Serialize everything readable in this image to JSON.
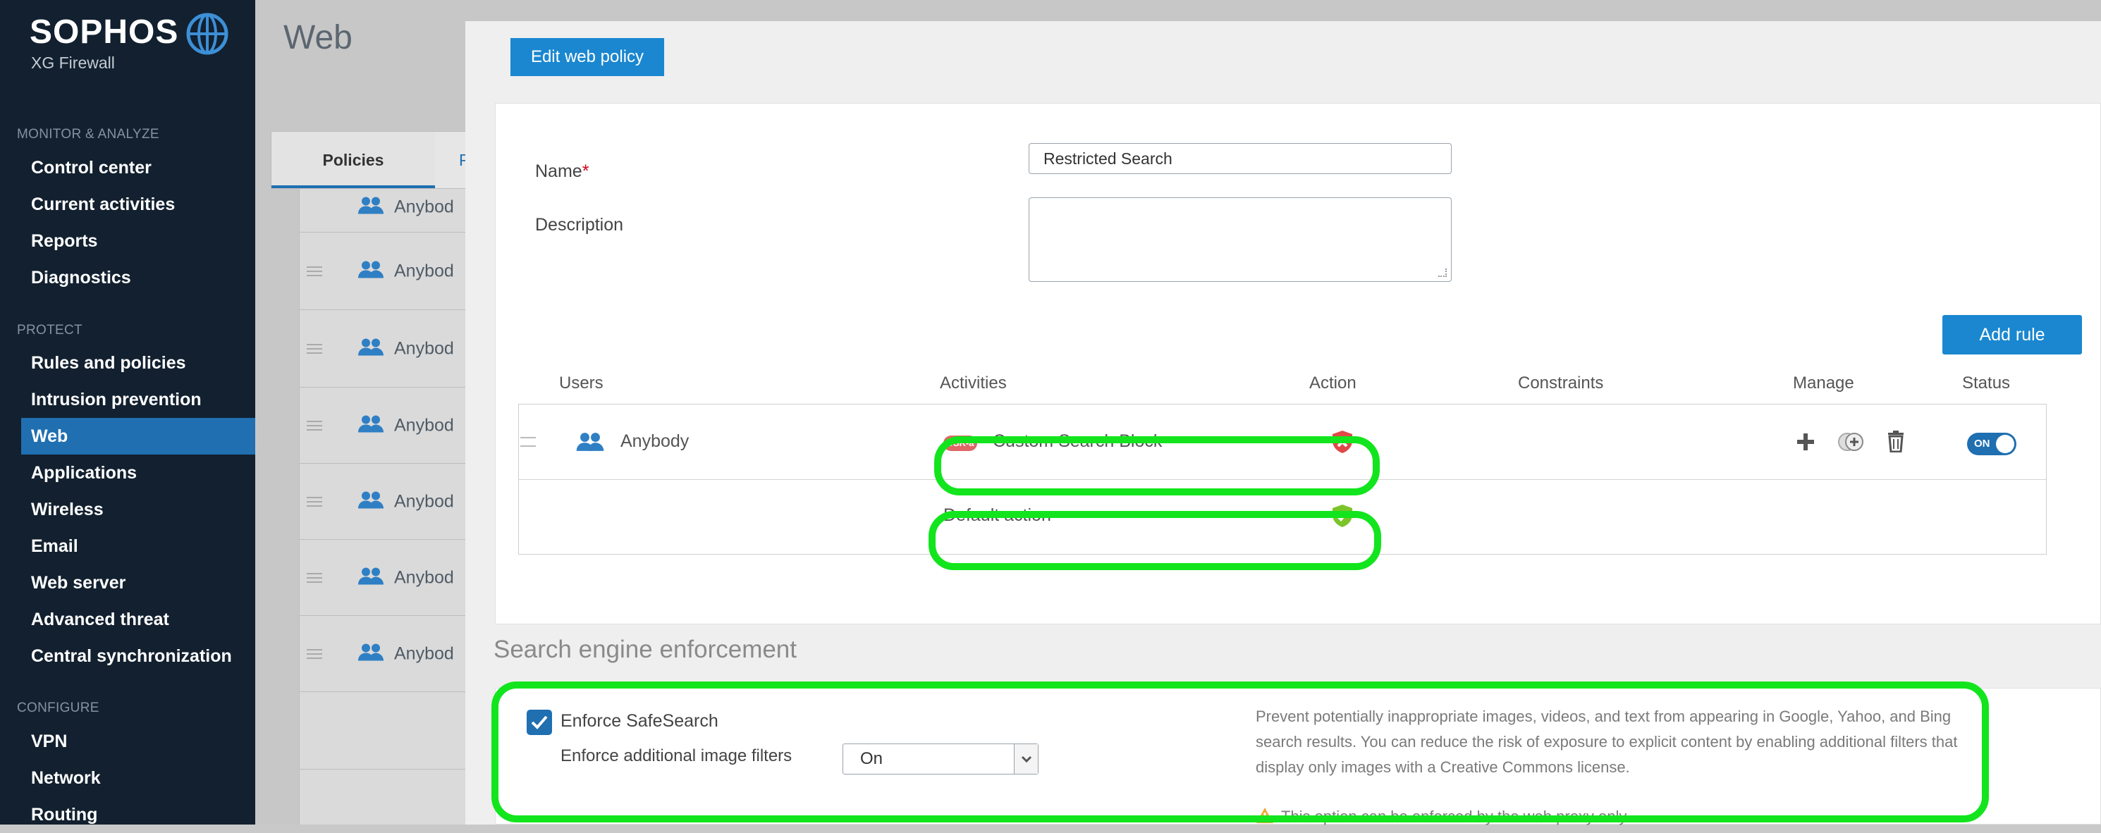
{
  "brand": {
    "name": "SOPHOS",
    "product": "XG Firewall"
  },
  "nav": {
    "sections": [
      {
        "label": "MONITOR & ANALYZE",
        "items": [
          "Control center",
          "Current activities",
          "Reports",
          "Diagnostics"
        ]
      },
      {
        "label": "PROTECT",
        "items": [
          "Rules and policies",
          "Intrusion prevention",
          "Web",
          "Applications",
          "Wireless",
          "Email",
          "Web server",
          "Advanced threat",
          "Central synchronization"
        ]
      },
      {
        "label": "CONFIGURE",
        "items": [
          "VPN",
          "Network",
          "Routing"
        ]
      }
    ],
    "active": "Web"
  },
  "page": {
    "title": "Web",
    "tabs": [
      "Policies",
      "Po"
    ],
    "bg_rows": [
      "Anybod",
      "Anybod",
      "Anybod",
      "Anybod",
      "Anybod",
      "Anybod",
      "Anybod"
    ]
  },
  "modal": {
    "title_button": "Edit web policy",
    "name_label": "Name",
    "name_required": "*",
    "name_value": "Restricted Search",
    "description_label": "Description",
    "description_value": "",
    "add_rule": "Add rule",
    "columns": [
      "Users",
      "Activities",
      "Action",
      "Constraints",
      "Manage",
      "Status"
    ],
    "rules": [
      {
        "user": "Anybody",
        "activity_badge": "USR-a",
        "activity": "Custom Search Block",
        "action": "block",
        "status": "ON"
      }
    ],
    "default_action_label": "Default action",
    "default_action": "allow"
  },
  "search_engine": {
    "title": "Search engine enforcement",
    "enforce_safesearch_label": "Enforce SafeSearch",
    "enforce_safesearch_checked": true,
    "image_filters_label": "Enforce additional image filters",
    "image_filters_value": "On",
    "help_text": "Prevent potentially inappropriate images, videos, and text from appearing in Google, Yahoo, and Bing search results. You can reduce the risk of exposure to explicit content by enabling additional filters that display only images with a Creative Commons license.",
    "warning": "This option can be enforced by the web proxy only."
  },
  "colors": {
    "primary": "#1a87d0",
    "sidebar": "#12202f",
    "active_nav": "#1f6fb1",
    "highlight": "#12e51d",
    "block": "#e04848",
    "allow": "#7bc42a"
  }
}
